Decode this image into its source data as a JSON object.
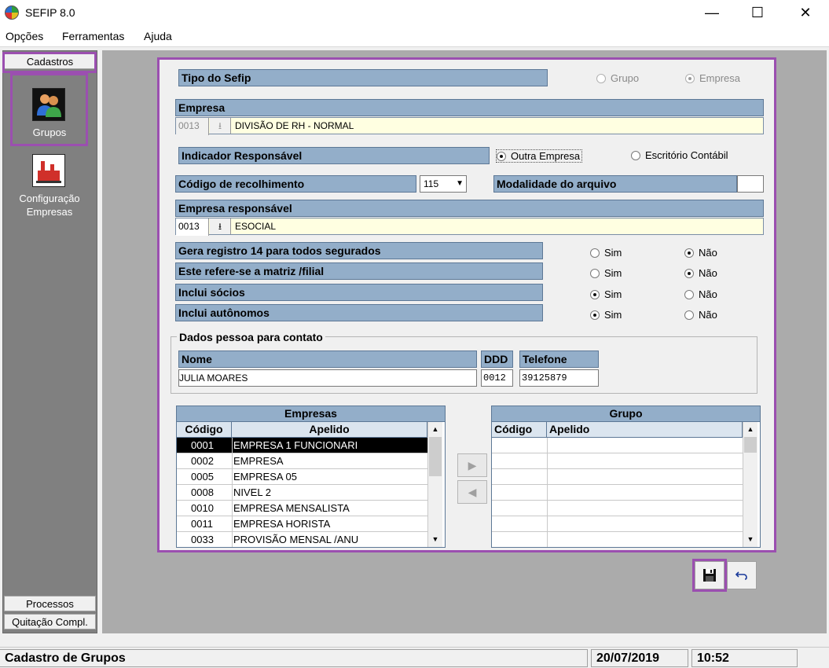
{
  "window": {
    "title": "SEFIP 8.0",
    "minimize": "—",
    "maximize": "☐",
    "close": "✕"
  },
  "menu": [
    "Opções",
    "Ferramentas",
    "Ajuda"
  ],
  "sidebar": {
    "header": "Cadastros",
    "items": [
      {
        "label": "Grupos"
      },
      {
        "label": "Configuração\nEmpresas"
      }
    ],
    "bottom": [
      "Processos",
      "Quitação Compl."
    ]
  },
  "form": {
    "tipo": {
      "label": "Tipo do Sefip",
      "opt_grupo": "Grupo",
      "opt_empresa": "Empresa",
      "selected": "Empresa"
    },
    "empresa": {
      "label": "Empresa",
      "code": "0013",
      "name": "DIVISÃO DE RH - NORMAL"
    },
    "indicador": {
      "label": "Indicador Responsável",
      "opt1": "Outra Empresa",
      "opt2": "Escritório Contábil",
      "selected": "Outra Empresa"
    },
    "codigo_recolhimento": {
      "label": "Código de recolhimento",
      "value": "115"
    },
    "modalidade": {
      "label": "Modalidade do arquivo",
      "value": ""
    },
    "empresa_responsavel": {
      "label": "Empresa responsável",
      "code": "0013",
      "name": "ESOCIAL"
    },
    "options": [
      {
        "label": "Gera registro 14 para todos segurados",
        "sim": "Sim",
        "nao": "Não",
        "selected": "Não"
      },
      {
        "label": "Este refere-se a matriz /filial",
        "sim": "Sim",
        "nao": "Não",
        "selected": "Não"
      },
      {
        "label": "Inclui sócios",
        "sim": "Sim",
        "nao": "Não",
        "selected": "Sim"
      },
      {
        "label": "Inclui autônomos",
        "sim": "Sim",
        "nao": "Não",
        "selected": "Sim"
      }
    ],
    "contato": {
      "legend": "Dados pessoa para contato",
      "nome_label": "Nome",
      "nome": "JULIA MOARES",
      "ddd_label": "DDD",
      "ddd": "0012",
      "telefone_label": "Telefone",
      "telefone": "39125879"
    }
  },
  "empresas_grid": {
    "title": "Empresas",
    "col_codigo": "Código",
    "col_apelido": "Apelido",
    "rows": [
      {
        "codigo": "0001",
        "apelido": "EMPRESA 1 FUNCIONARI"
      },
      {
        "codigo": "0002",
        "apelido": "EMPRESA"
      },
      {
        "codigo": "0005",
        "apelido": "EMPRESA 05"
      },
      {
        "codigo": "0008",
        "apelido": "NIVEL 2"
      },
      {
        "codigo": "0010",
        "apelido": "EMPRESA MENSALISTA"
      },
      {
        "codigo": "0011",
        "apelido": "EMPRESA HORISTA"
      },
      {
        "codigo": "0033",
        "apelido": "PROVISÃO MENSAL /ANU"
      }
    ],
    "selected_index": 0
  },
  "grupo_grid": {
    "title": "Grupo",
    "col_codigo": "Código",
    "col_apelido": "Apelido",
    "rows": []
  },
  "status": {
    "text": "Cadastro de Grupos",
    "date": "20/07/2019",
    "time": "10:52"
  },
  "colors": {
    "highlight": "#9b4fb0",
    "bar": "#93aec9",
    "field": "#ffffe1"
  }
}
